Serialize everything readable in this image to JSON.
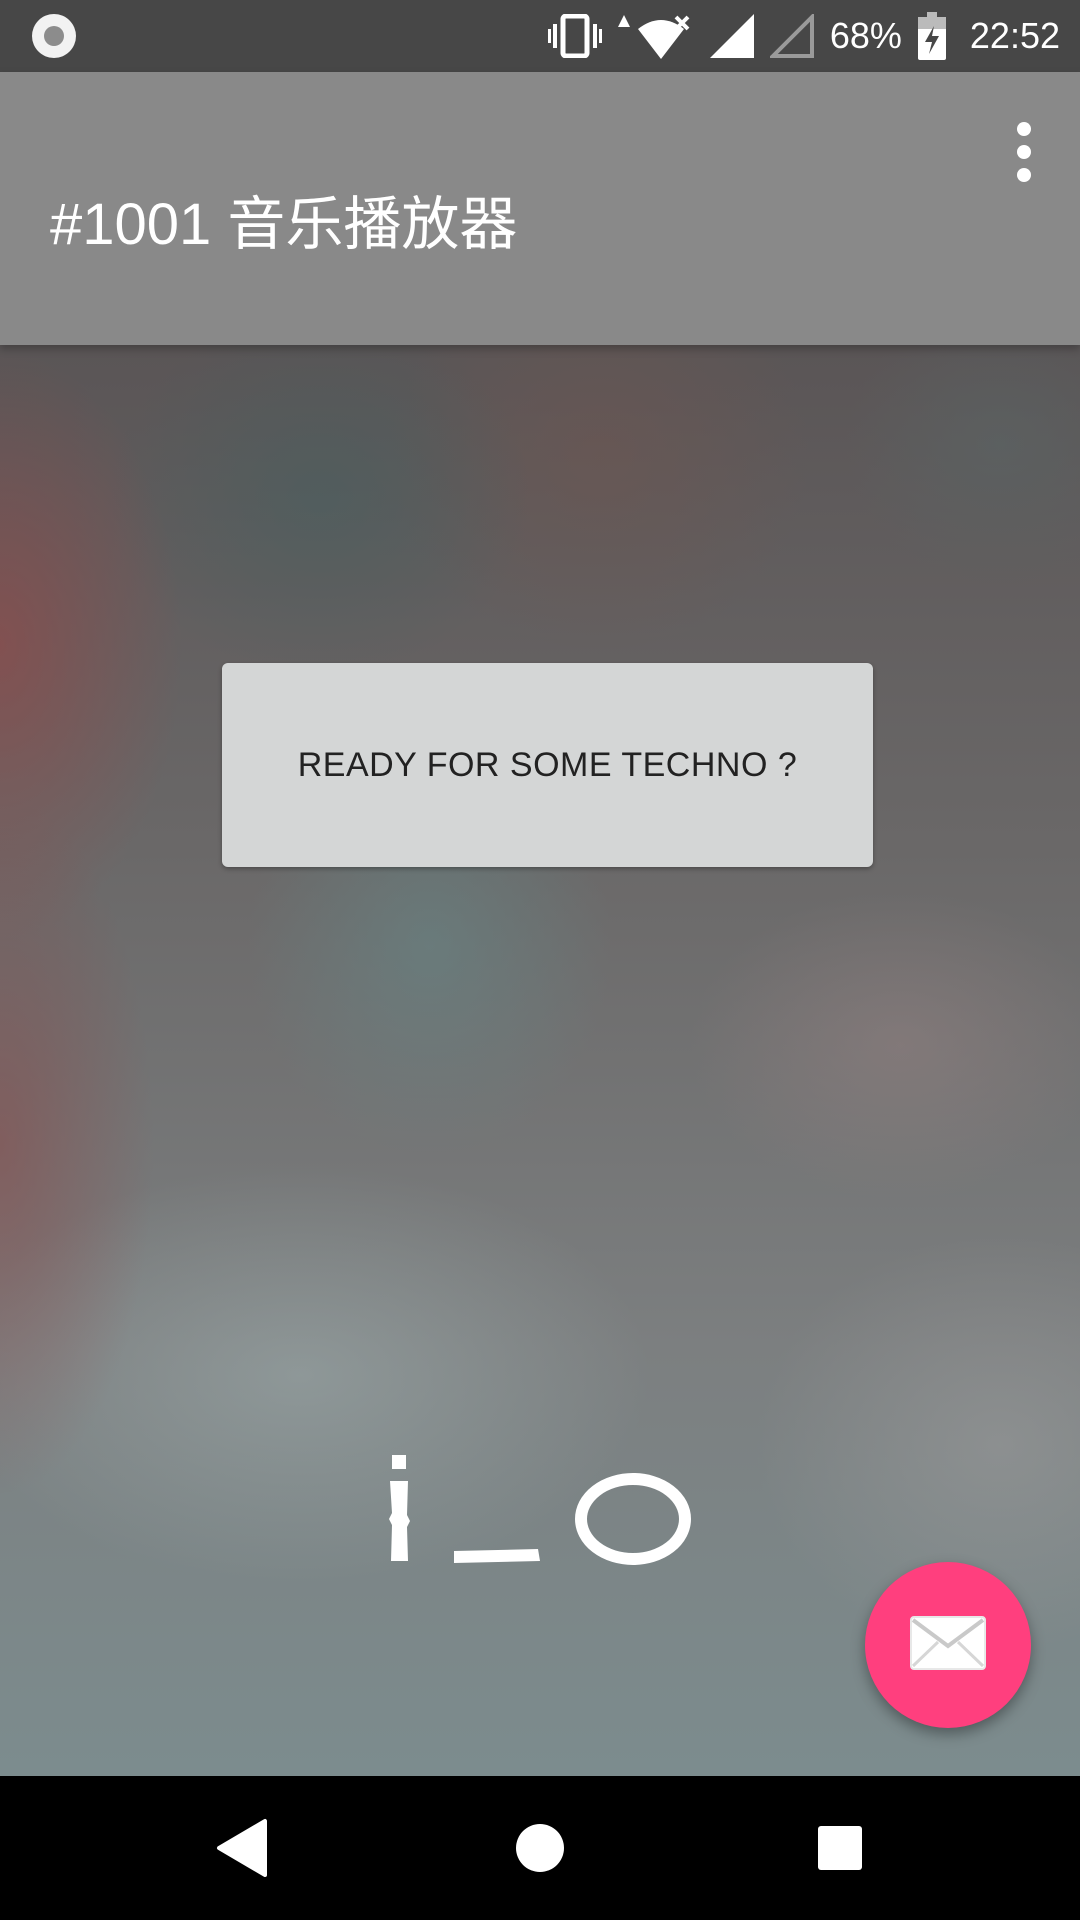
{
  "status_bar": {
    "left_icon": "record-circle-icon",
    "icons": [
      "vibrate-icon",
      "data-upload-arrow-icon",
      "wifi-icon",
      "signal-icon",
      "signal-empty-icon",
      "battery-charging-icon"
    ],
    "battery": "68%",
    "time": "22:52"
  },
  "app_bar": {
    "title": "#1001 音乐播放器",
    "overflow_icon": "more-vert-icon"
  },
  "main": {
    "button_label": "READY FOR SOME TECHNO ?",
    "logo_icon": "i-o-logo-icon"
  },
  "fab": {
    "icon": "mail-icon",
    "color": "#ff3f7e"
  },
  "nav_bar": {
    "icons": [
      "back-icon",
      "home-icon",
      "recents-icon"
    ]
  },
  "colors": {
    "status_bar": "#474747",
    "app_bar": "#898989",
    "button_bg": "#d4d6d6",
    "nav_bar": "#000000"
  }
}
